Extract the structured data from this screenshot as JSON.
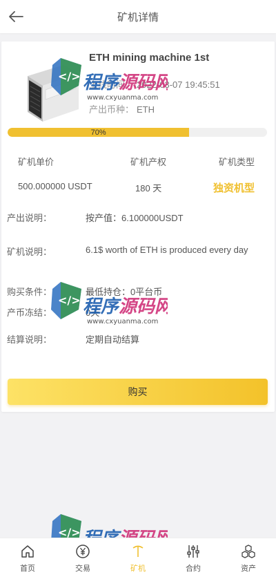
{
  "header": {
    "title": "矿机详情",
    "back_icon": "arrow-left-icon"
  },
  "machine": {
    "name": "ETH mining machine 1st",
    "time_label": "上线时间：",
    "time_value": "2022-03-07 19:45:51",
    "coin_label": "产出币种：",
    "coin_value": "ETH"
  },
  "progress": {
    "percent": 70,
    "label": "70%",
    "color": "#f0c030"
  },
  "stats": {
    "price_label": "矿机单价",
    "price_value": "500.000000 USDT",
    "term_label": "矿机产权",
    "term_value": "180 天",
    "type_label": "矿机类型",
    "type_value": "独资机型"
  },
  "info": [
    {
      "label": "产出说明：",
      "value": "按产值：6.100000USDT"
    },
    {
      "label": "矿机说明：",
      "value": "6.1$ worth of ETH is produced every day"
    },
    {
      "label": "购买条件：",
      "value": "最低持仓：0平台币"
    },
    {
      "label": "产币冻结：",
      "value": "0天"
    },
    {
      "label": "结算说明：",
      "value": "定期自动结算"
    }
  ],
  "buy_button": {
    "label": "购买"
  },
  "watermark": {
    "brand": "程序源码网",
    "url": "www.cxyuanma.com"
  },
  "tabbar": [
    {
      "label": "首页",
      "icon": "home-icon",
      "active": false
    },
    {
      "label": "交易",
      "icon": "yen-coin-icon",
      "active": false
    },
    {
      "label": "矿机",
      "icon": "pickaxe-icon",
      "active": true
    },
    {
      "label": "合约",
      "icon": "sliders-icon",
      "active": false
    },
    {
      "label": "资产",
      "icon": "cubes-icon",
      "active": false
    }
  ],
  "colors": {
    "accent": "#f0c030",
    "background": "#f2f2f4"
  }
}
